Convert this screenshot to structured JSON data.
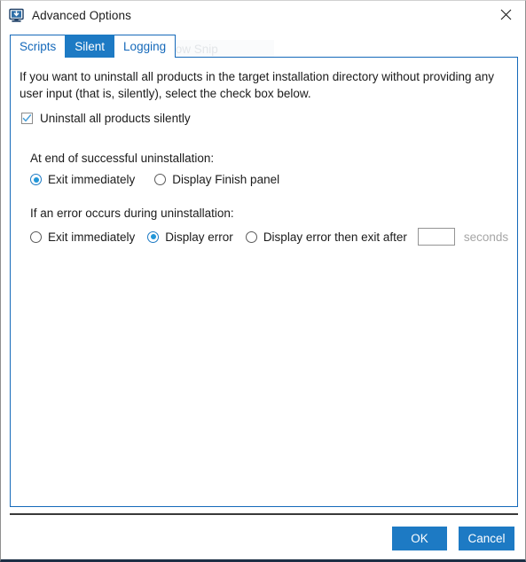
{
  "window": {
    "title": "Advanced Options",
    "icon": "installer-icon",
    "close_label": "close-icon"
  },
  "watermark": {
    "text": "Window Snip"
  },
  "tabs": [
    {
      "label": "Scripts",
      "active": false
    },
    {
      "label": "Silent",
      "active": true
    },
    {
      "label": "Logging",
      "active": false
    }
  ],
  "panel": {
    "intro": "If you want to uninstall all products in the target installation directory without providing any user input (that is, silently), select the check box below.",
    "silent_checkbox": {
      "label": "Uninstall all products silently",
      "checked": true
    },
    "success_group": {
      "title": "At end of successful uninstallation:",
      "options": [
        {
          "label": "Exit immediately",
          "selected": true
        },
        {
          "label": "Display Finish panel",
          "selected": false
        }
      ]
    },
    "error_group": {
      "title": "If an error occurs during uninstallation:",
      "options": [
        {
          "label": "Exit immediately",
          "selected": false
        },
        {
          "label": "Display error",
          "selected": true
        },
        {
          "label": "Display error then exit after",
          "selected": false
        }
      ],
      "seconds_value": "",
      "seconds_placeholder": "",
      "seconds_label": "seconds"
    }
  },
  "footer": {
    "ok_label": "OK",
    "cancel_label": "Cancel"
  },
  "colors": {
    "accent": "#1d7ac4",
    "tab_border": "#1569ba",
    "title_text": "#1b1b1b",
    "disabled_text": "#a6a6a6",
    "window_bottom": "#1d3046"
  }
}
